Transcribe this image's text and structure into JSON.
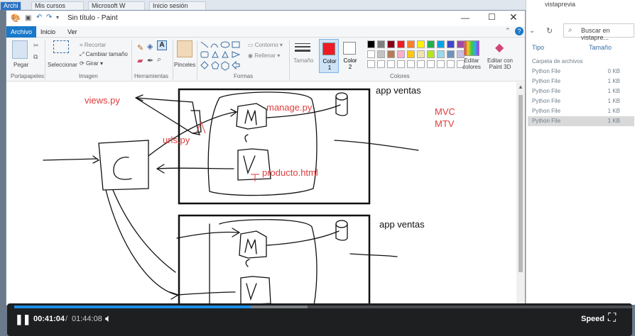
{
  "browser": {
    "tabs": [
      {
        "label": "Mis cursos"
      },
      {
        "label": "Microsoft W"
      },
      {
        "label": "Inicio sesión"
      }
    ]
  },
  "explorer": {
    "title": "vistaprevia",
    "search_placeholder": "Buscar en vistapre...",
    "columns": {
      "type": "Tipo",
      "size": "Tamaño"
    },
    "rows": [
      {
        "type": "Carpeta de archivos",
        "size": ""
      },
      {
        "type": "Python File",
        "size": "0 KB"
      },
      {
        "type": "Python File",
        "size": "1 KB"
      },
      {
        "type": "Python File",
        "size": "1 KB"
      },
      {
        "type": "Python File",
        "size": "1 KB"
      },
      {
        "type": "Python File",
        "size": "1 KB"
      },
      {
        "type": "Python File",
        "size": "1 KB"
      }
    ]
  },
  "paint": {
    "title": "Sin título - Paint",
    "menu": {
      "file": "Archivo",
      "home": "Inicio",
      "view": "Ver"
    },
    "ribbon": {
      "paste": "Pegar",
      "select": "Seleccionar",
      "crop": "Recortar",
      "resize": "Cambiar tamaño",
      "rotate": "Girar",
      "brushes": "Pinceles",
      "outline": "Contorno",
      "fill": "Rellenar",
      "size": "Tamaño",
      "color1": "Color 1",
      "color2": "Color 2",
      "edit_colors": "Editar colores",
      "edit_paint3d": "Editar con Paint 3D",
      "groups": {
        "clipboard": "Portapapeles",
        "image": "Imagen",
        "tools": "Herramientas",
        "shapes": "Formas",
        "colors": "Colores"
      }
    },
    "palette": [
      "#000000",
      "#7f7f7f",
      "#880015",
      "#ed1c24",
      "#ff7f27",
      "#fff200",
      "#22b14c",
      "#00a2e8",
      "#3f48cc",
      "#a349a4",
      "#ffffff",
      "#c3c3c3",
      "#b97a57",
      "#ffaec9",
      "#ffc90e",
      "#efe4b0",
      "#b5e61d",
      "#99d9ea",
      "#7092be",
      "#c8bfe7"
    ],
    "color1_value": "#ed1c24",
    "canvas": {
      "views": "views.py",
      "manage": "manage.py",
      "urls": "urls.py",
      "producto": "producto.html",
      "app1": "app ventas",
      "app2": "app ventas",
      "mvc": "MVC",
      "mtv": "MTV",
      "m1": "M",
      "v1": "V",
      "m2": "M",
      "v2": "V"
    }
  },
  "player": {
    "current_time": "00:41:04",
    "separator": "/",
    "total_time": "01:44:08",
    "progress": 0.383,
    "buffered": 0.475,
    "speed_label": "Speed"
  }
}
